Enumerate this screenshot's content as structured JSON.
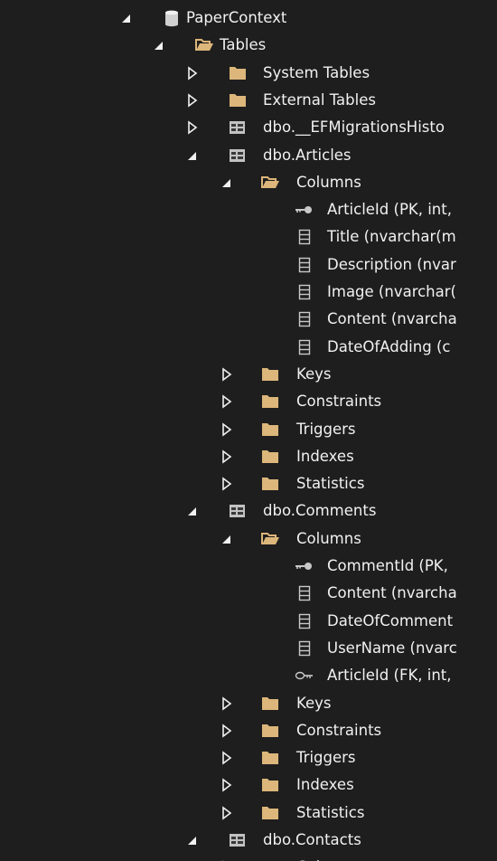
{
  "tree": [
    {
      "label": "PaperContext",
      "depth": 0,
      "state": "expanded",
      "icon": "database-icon",
      "name": "tree-node-papercontext"
    },
    {
      "label": "Tables",
      "depth": 1,
      "state": "expanded",
      "icon": "folder-open-icon",
      "name": "tree-node-tables"
    },
    {
      "label": "System Tables",
      "depth": 2,
      "state": "collapsed",
      "icon": "folder-icon",
      "name": "tree-node-system-tables"
    },
    {
      "label": "External Tables",
      "depth": 2,
      "state": "collapsed",
      "icon": "folder-icon",
      "name": "tree-node-external-tables"
    },
    {
      "label": "dbo.__EFMigrationsHisto",
      "depth": 2,
      "state": "collapsed",
      "icon": "table-icon",
      "name": "tree-node-efmigrationshistory"
    },
    {
      "label": "dbo.Articles",
      "depth": 2,
      "state": "expanded",
      "icon": "table-icon",
      "name": "tree-node-articles"
    },
    {
      "label": "Columns",
      "depth": 3,
      "state": "expanded",
      "icon": "folder-open-icon",
      "name": "tree-node-articles-columns"
    },
    {
      "label": "ArticleId (PK, int,",
      "depth": 4,
      "state": "leaf",
      "icon": "primary-key-icon",
      "name": "tree-node-column-articleid"
    },
    {
      "label": "Title (nvarchar(m",
      "depth": 4,
      "state": "leaf",
      "icon": "column-icon",
      "name": "tree-node-column-title"
    },
    {
      "label": "Description (nvar",
      "depth": 4,
      "state": "leaf",
      "icon": "column-icon",
      "name": "tree-node-column-description"
    },
    {
      "label": "Image (nvarchar(",
      "depth": 4,
      "state": "leaf",
      "icon": "column-icon",
      "name": "tree-node-column-image"
    },
    {
      "label": "Content (nvarcha",
      "depth": 4,
      "state": "leaf",
      "icon": "column-icon",
      "name": "tree-node-column-content"
    },
    {
      "label": "DateOfAdding (c",
      "depth": 4,
      "state": "leaf",
      "icon": "column-icon",
      "name": "tree-node-column-dateofadding"
    },
    {
      "label": "Keys",
      "depth": 3,
      "state": "collapsed",
      "icon": "folder-icon",
      "name": "tree-node-articles-keys"
    },
    {
      "label": "Constraints",
      "depth": 3,
      "state": "collapsed",
      "icon": "folder-icon",
      "name": "tree-node-articles-constraints"
    },
    {
      "label": "Triggers",
      "depth": 3,
      "state": "collapsed",
      "icon": "folder-icon",
      "name": "tree-node-articles-triggers"
    },
    {
      "label": "Indexes",
      "depth": 3,
      "state": "collapsed",
      "icon": "folder-icon",
      "name": "tree-node-articles-indexes"
    },
    {
      "label": "Statistics",
      "depth": 3,
      "state": "collapsed",
      "icon": "folder-icon",
      "name": "tree-node-articles-statistics"
    },
    {
      "label": "dbo.Comments",
      "depth": 2,
      "state": "expanded",
      "icon": "table-icon",
      "name": "tree-node-comments"
    },
    {
      "label": "Columns",
      "depth": 3,
      "state": "expanded",
      "icon": "folder-open-icon",
      "name": "tree-node-comments-columns"
    },
    {
      "label": "CommentId (PK,",
      "depth": 4,
      "state": "leaf",
      "icon": "primary-key-icon",
      "name": "tree-node-column-commentid"
    },
    {
      "label": "Content (nvarcha",
      "depth": 4,
      "state": "leaf",
      "icon": "column-icon",
      "name": "tree-node-column-comment-content"
    },
    {
      "label": "DateOfComment",
      "depth": 4,
      "state": "leaf",
      "icon": "column-icon",
      "name": "tree-node-column-dateofcomment"
    },
    {
      "label": "UserName (nvarc",
      "depth": 4,
      "state": "leaf",
      "icon": "column-icon",
      "name": "tree-node-column-username"
    },
    {
      "label": "ArticleId (FK, int,",
      "depth": 4,
      "state": "leaf",
      "icon": "foreign-key-icon",
      "name": "tree-node-column-fk-articleid"
    },
    {
      "label": "Keys",
      "depth": 3,
      "state": "collapsed",
      "icon": "folder-icon",
      "name": "tree-node-comments-keys"
    },
    {
      "label": "Constraints",
      "depth": 3,
      "state": "collapsed",
      "icon": "folder-icon",
      "name": "tree-node-comments-constraints"
    },
    {
      "label": "Triggers",
      "depth": 3,
      "state": "collapsed",
      "icon": "folder-icon",
      "name": "tree-node-comments-triggers"
    },
    {
      "label": "Indexes",
      "depth": 3,
      "state": "collapsed",
      "icon": "folder-icon",
      "name": "tree-node-comments-indexes"
    },
    {
      "label": "Statistics",
      "depth": 3,
      "state": "collapsed",
      "icon": "folder-icon",
      "name": "tree-node-comments-statistics"
    },
    {
      "label": "dbo.Contacts",
      "depth": 2,
      "state": "expanded",
      "icon": "table-icon",
      "name": "tree-node-contacts"
    },
    {
      "label": "Columns",
      "depth": 3,
      "state": "collapsed",
      "icon": "folder-icon",
      "name": "tree-node-contacts-columns"
    }
  ],
  "colors": {
    "background": "#1e1e1e",
    "text": "#f1f1f1",
    "folder": "#dcb67a",
    "icon": "#c8c8c8",
    "table_icon": "#e8e8e8"
  }
}
